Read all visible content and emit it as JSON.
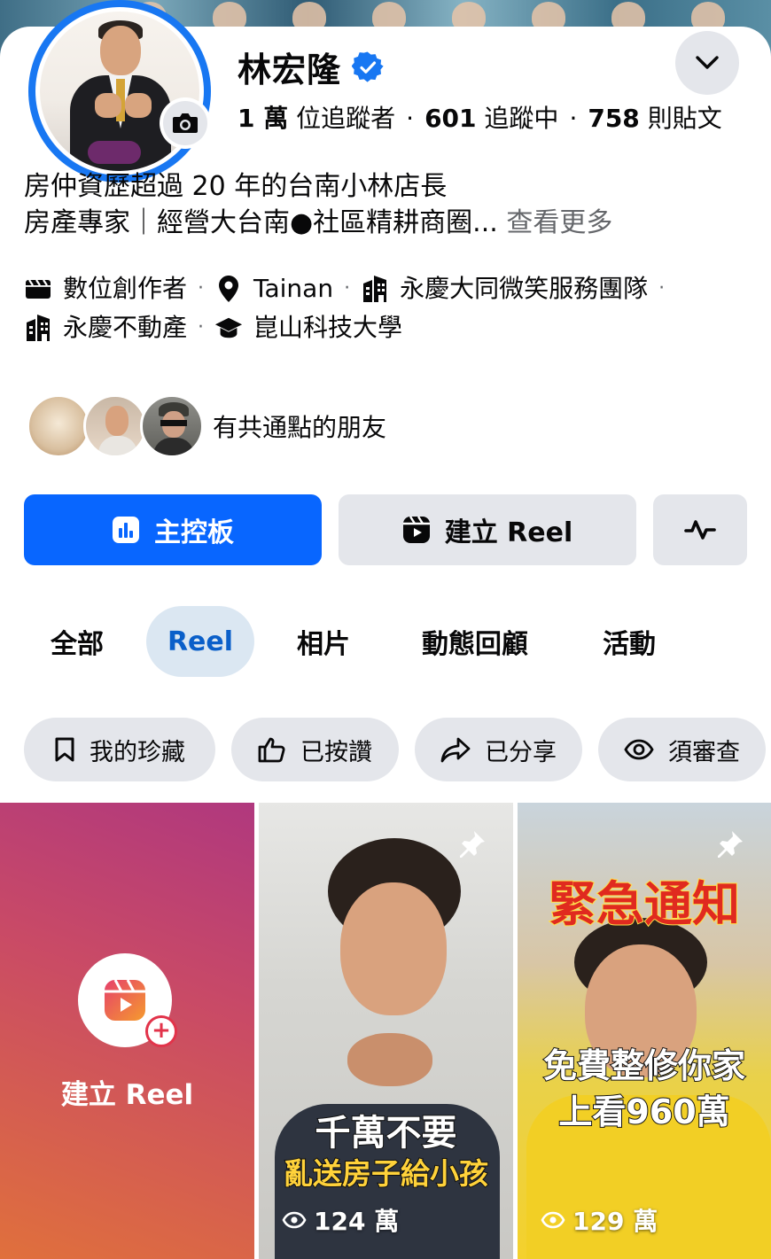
{
  "profile": {
    "name": "林宏隆",
    "followers_value": "1 萬",
    "followers_label": "位追蹤者",
    "following_value": "601",
    "following_label": "追蹤中",
    "posts_value": "758",
    "posts_label": "則貼文",
    "dot": "·"
  },
  "bio": {
    "line1": "房仲資歷超過 20 年的台南小林店長",
    "line2": "房產專家｜經營大台南●社區精耕商圈...",
    "see_more": "查看更多"
  },
  "intro": {
    "category": "數位創作者",
    "location": "Tainan",
    "work1": "永慶大同微笑服務團隊",
    "work2": "永慶不動產",
    "school": "崑山科技大學",
    "sep": "·"
  },
  "mutual": {
    "label": "有共通點的朋友"
  },
  "actions": {
    "dashboard": "主控板",
    "create_reel": "建立 Reel"
  },
  "tabs": [
    {
      "label": "全部"
    },
    {
      "label": "Reel"
    },
    {
      "label": "相片"
    },
    {
      "label": "動態回顧"
    },
    {
      "label": "活動"
    }
  ],
  "chips": [
    {
      "label": "我的珍藏"
    },
    {
      "label": "已按讚"
    },
    {
      "label": "已分享"
    },
    {
      "label": "須審查"
    }
  ],
  "reels": {
    "create_label": "建立 Reel",
    "items": [
      {
        "caption_line1": "千萬不要",
        "caption_line2": "亂送房子給小孩",
        "views": "124 萬"
      },
      {
        "caption_top": "緊急通知",
        "caption_line1": "免費整修你家",
        "caption_line2": "上看960萬",
        "views": "129 萬"
      }
    ]
  },
  "colors": {
    "primary": "#0866ff",
    "button_gray": "#e4e6eb",
    "active_tab_bg": "#dbe7f2",
    "active_tab_text": "#0a5fc9",
    "muted": "#65676b"
  }
}
